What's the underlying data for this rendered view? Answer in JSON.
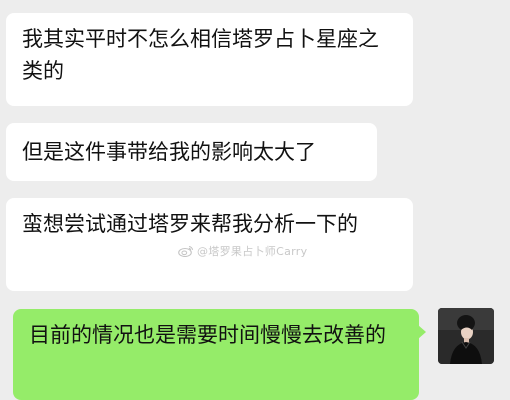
{
  "chat": {
    "messages": [
      {
        "from": "other",
        "text": "我其实平时不怎么相信塔罗占卜星座之类的"
      },
      {
        "from": "other",
        "text": "但是这件事带给我的影响太大了"
      },
      {
        "from": "other",
        "text": "蛮想尝试通过塔罗来帮我分析一下的"
      },
      {
        "from": "self",
        "text": "目前的情况也是需要时间慢慢去改善的"
      }
    ]
  },
  "watermark": {
    "text": "@塔罗果占卜师Carry",
    "icon": "weibo-icon"
  },
  "self_avatar": {
    "icon": "avatar-woman-portrait",
    "background": "#2a2a2a"
  },
  "colors": {
    "background": "#ededed",
    "incoming_bubble": "#ffffff",
    "outgoing_bubble": "#95ec69",
    "text": "#111111"
  }
}
